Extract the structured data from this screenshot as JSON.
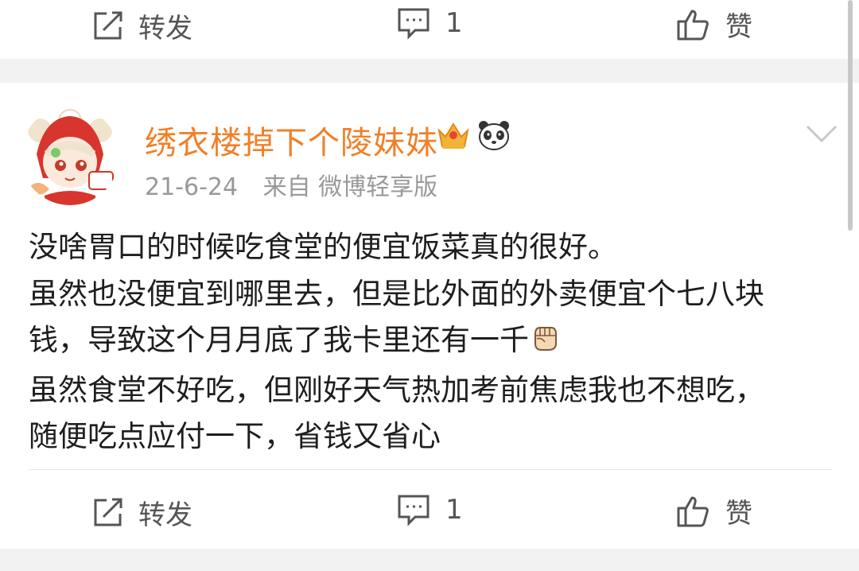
{
  "top_actions": {
    "repost_label": "转发",
    "comment_count": "1",
    "like_label": "赞"
  },
  "post": {
    "username": "绣衣楼掉下个陵妹妹",
    "date": "21-6-24",
    "source": "来自 微博轻享版",
    "lines": [
      "没啥胃口的时候吃食堂的便宜饭菜真的很好。",
      "虽然也没便宜到哪里去，但是比外面的外卖便宜个七八块",
      "钱，导致这个月月底了我卡里还有一千",
      "虽然食堂不好吃，但刚好天气热加考前焦虑我也不想吃，",
      "随便吃点应付一下，省钱又省心"
    ],
    "emoji_after_line_3": "fist-emoji",
    "badges": [
      "crown-icon",
      "panda-icon"
    ]
  },
  "bottom_actions": {
    "repost_label": "转发",
    "comment_count": "1",
    "like_label": "赞"
  },
  "colors": {
    "username": "#f08028",
    "meta": "#999999",
    "action": "#555555",
    "separator": "#f2f2f2"
  }
}
